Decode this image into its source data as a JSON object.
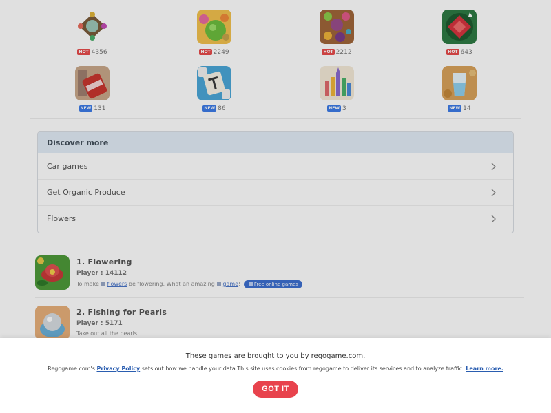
{
  "games_grid": [
    {
      "badge": "HOT",
      "count": "4356",
      "icon": "compass-gem-icon",
      "accent": "#7a5a3a"
    },
    {
      "badge": "HOT",
      "count": "2249",
      "icon": "fruit-match-icon",
      "accent": "#66b93a"
    },
    {
      "badge": "HOT",
      "count": "2212",
      "icon": "fruit-board-icon",
      "accent": "#9a4e8c"
    },
    {
      "badge": "HOT",
      "count": "643",
      "icon": "red-gem-icon",
      "accent": "#d8343f"
    },
    {
      "badge": "NEW",
      "count": "131",
      "icon": "soda-can-icon",
      "accent": "#c9362e"
    },
    {
      "badge": "NEW",
      "count": "86",
      "icon": "mahjong-tile-icon",
      "accent": "#4aa7d8"
    },
    {
      "badge": "NEW",
      "count": "3",
      "icon": "castle-icon",
      "accent": "#e8d3b0"
    },
    {
      "badge": "NEW",
      "count": "14",
      "icon": "water-glass-icon",
      "accent": "#d9a25a"
    }
  ],
  "discover": {
    "heading": "Discover more",
    "items": [
      "Car games",
      "Get Organic Produce",
      "Flowers"
    ]
  },
  "ranked": [
    {
      "title": "1. Flowering",
      "players": "Player : 14112",
      "desc_pre": "To make",
      "desc_link1": "flowers",
      "desc_mid": "be flowering, What an amazing",
      "desc_link2": "game",
      "desc_post": "!",
      "pill": "Free online games",
      "icon": "lotus-flower-icon"
    },
    {
      "title": "2. Fishing for Pearls",
      "players": "Player : 5171",
      "desc": "Take out all the pearls",
      "icon": "pearl-icon"
    }
  ],
  "consent": {
    "title": "These games are brought to you by regogame.com.",
    "text_pre": "Regogame.com's",
    "policy_link": "Privacy Policy",
    "text_mid": "sets out how we handle your data.This site uses cookies from regogame to deliver its services and to analyze traffic.",
    "learn_more": "Learn more.",
    "button": "GOT IT"
  },
  "colors": {
    "hot_badge": "#e84c4c",
    "new_badge": "#3d7be8",
    "got_it": "#e8434d",
    "discover_header": "#e2ecf6"
  }
}
